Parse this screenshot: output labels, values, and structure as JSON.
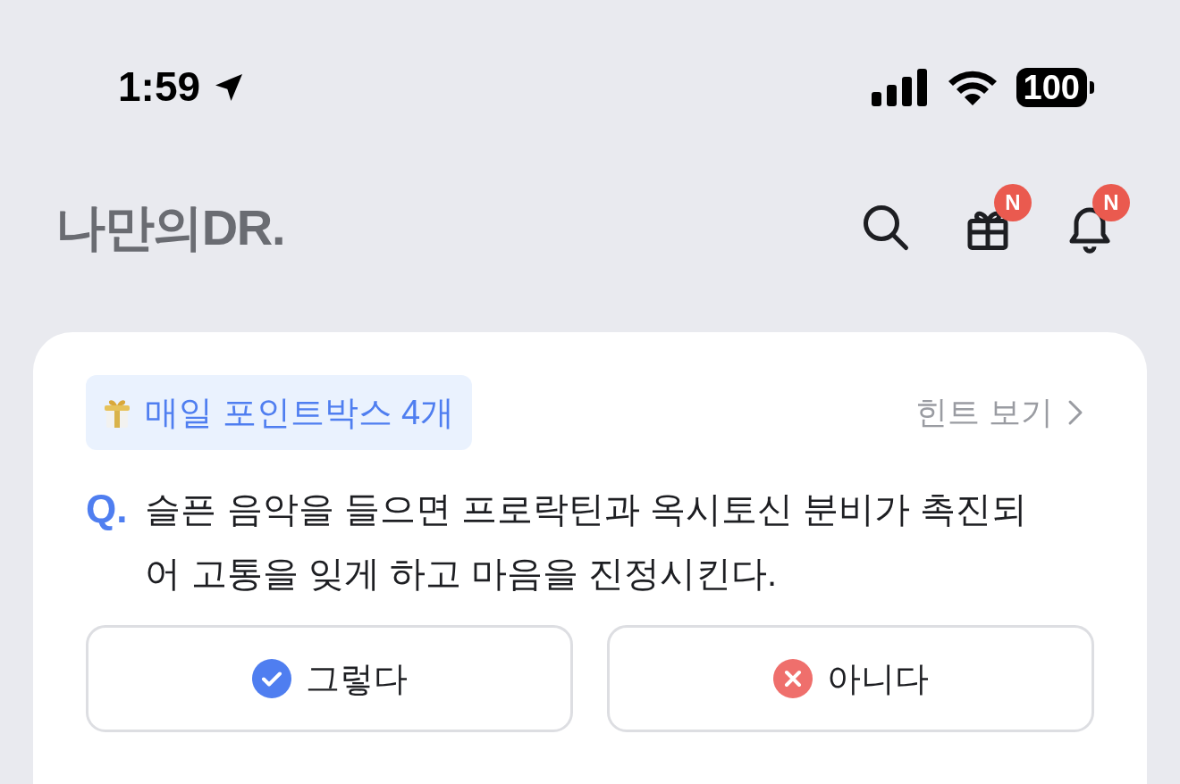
{
  "status_bar": {
    "time": "1:59",
    "battery": "100"
  },
  "header": {
    "logo": "나만의DR.",
    "gift_badge": "N",
    "bell_badge": "N"
  },
  "quiz": {
    "reward": "매일 포인트박스 4개",
    "hint_link": "힌트 보기",
    "q_mark": "Q.",
    "question": "슬픈 음악을 들으면 프로락틴과 옥시토신 분비가 촉진되어 고통을 잊게 하고 마음을 진정시킨다.",
    "answers": [
      {
        "kind": "yes",
        "label": "그렇다"
      },
      {
        "kind": "no",
        "label": "아니다"
      }
    ]
  }
}
